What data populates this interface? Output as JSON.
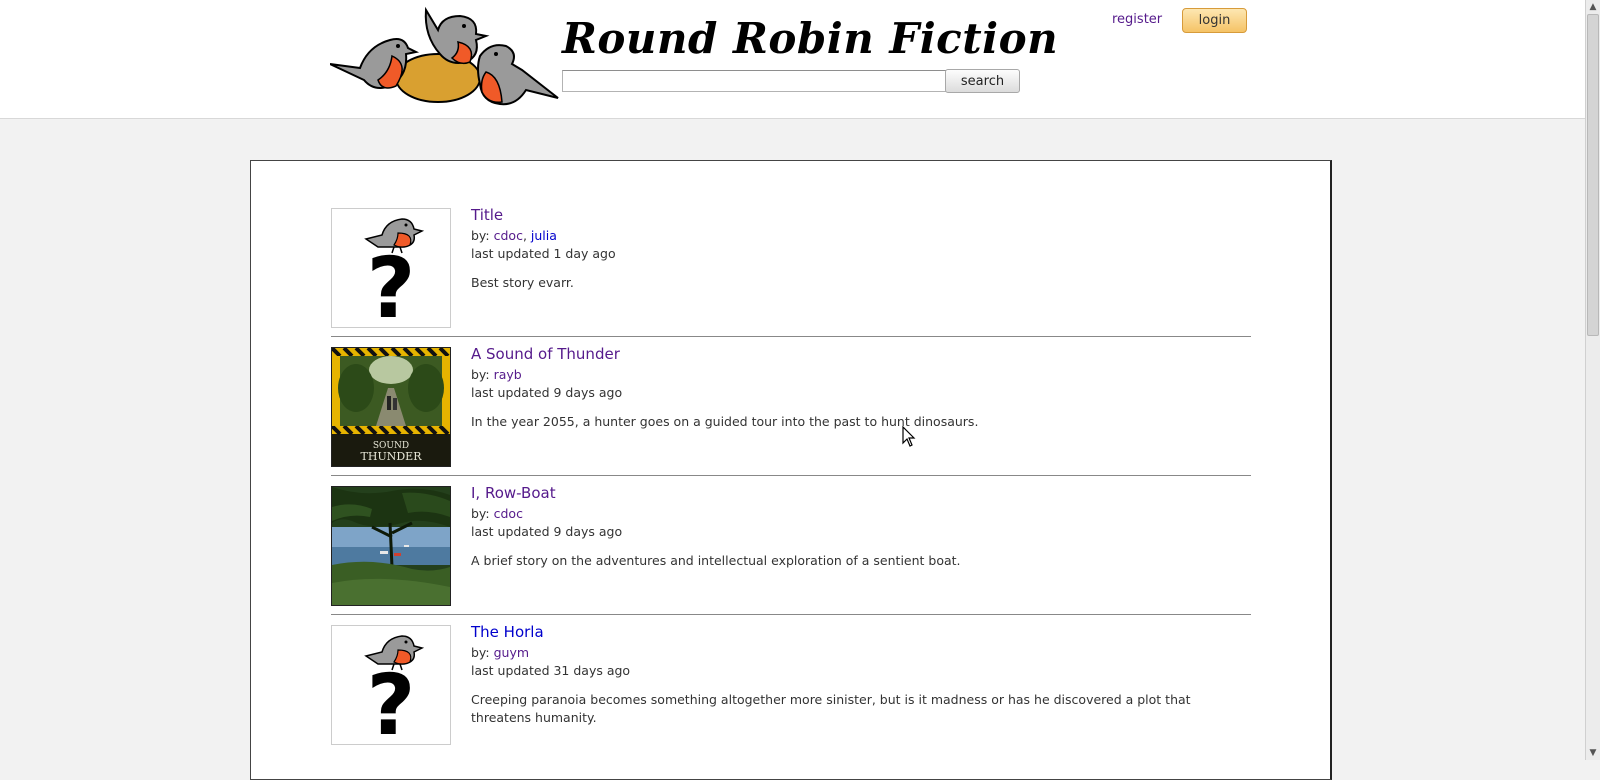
{
  "site": {
    "title": "Round Robin Fiction"
  },
  "header": {
    "search_placeholder": "",
    "search_value": "",
    "search_label": "search",
    "register_label": "register",
    "login_label": "login"
  },
  "stories": [
    {
      "title": "Title",
      "by_prefix": "by: ",
      "authors": [
        "cdoc",
        "julia"
      ],
      "updated": "last updated 1 day ago",
      "description": "Best story evarr.",
      "thumb": "placeholder-robin-question-icon"
    },
    {
      "title": "A Sound of Thunder",
      "by_prefix": "by: ",
      "authors": [
        "rayb"
      ],
      "updated": "last updated 9 days ago",
      "description": "In the year 2055, a hunter goes on a guided tour into the past to hunt dinosaurs.",
      "thumb": "sound-of-thunder-cover",
      "thumb_text": "SOUND THUNDER"
    },
    {
      "title": "I, Row-Boat",
      "by_prefix": "by: ",
      "authors": [
        "cdoc"
      ],
      "updated": "last updated 9 days ago",
      "description": "A brief story on the adventures and intellectual exploration of a sentient boat.",
      "thumb": "tree-and-boats-photo"
    },
    {
      "title": "The Horla",
      "by_prefix": "by: ",
      "authors": [
        "guym"
      ],
      "updated": "last updated 31 days ago",
      "description": "Creeping paranoia becomes something altogether more sinister, but is it madness or has he discovered a plot that threatens humanity.",
      "thumb": "placeholder-robin-question-icon"
    }
  ],
  "colors": {
    "visited_link": "#551a8b",
    "unvisited_link": "#0000cc",
    "robin_breast": "#f05a28",
    "robin_body": "#9a9a9a",
    "egg": "#d9a030"
  }
}
